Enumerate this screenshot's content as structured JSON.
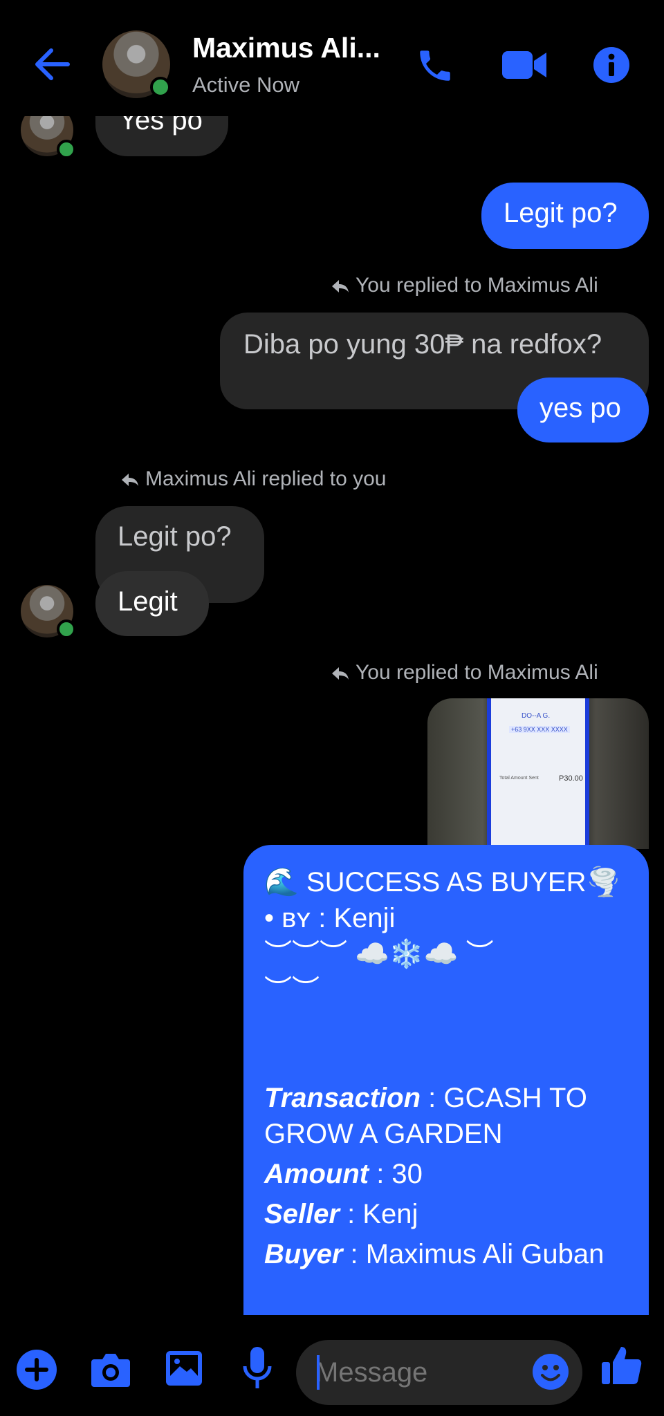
{
  "header": {
    "title": "Maximus Ali...",
    "status": "Active Now"
  },
  "messages": {
    "yes_po_in": "Yes po",
    "legit_po_out": "Legit po?",
    "reply1_label": "You replied to Maximus Ali",
    "quoted1": "Diba po yung 30₱ na redfox?",
    "yes_po_out": "yes po",
    "reply2_label": "Maximus Ali replied to you",
    "quoted2": "Legit po?",
    "legit_in": "Legit",
    "reply3_label": "You replied to Maximus Ali"
  },
  "photo": {
    "line1": "DO--A G.",
    "line2": "+63 9XX XXX XXXX",
    "amount_label": "Total Amount Sent",
    "amount": "P30.00"
  },
  "card": {
    "heading": "🌊 SUCCESS AS BUYER🌪️",
    "by_prefix": "• ʙʏ : ",
    "by_name": "Kenji",
    "deco1": "︶︶︶ ☁️❄️☁️ ︶",
    "deco2": "︶︶",
    "transaction_label": "Transaction",
    "transaction_value": " : GCASH TO GROW A GARDEN",
    "amount_label": "Amount",
    "amount_value": " : 30",
    "seller_label": "Seller",
    "seller_value": " : Kenj",
    "buyer_label": "Buyer",
    "buyer_value": " : Maximus Ali Guban"
  },
  "composer": {
    "placeholder": "Message"
  },
  "colors": {
    "accent": "#2962ff",
    "incoming_bubble": "#262626",
    "online": "#31a24c",
    "muted_text": "#b0b3b8"
  }
}
